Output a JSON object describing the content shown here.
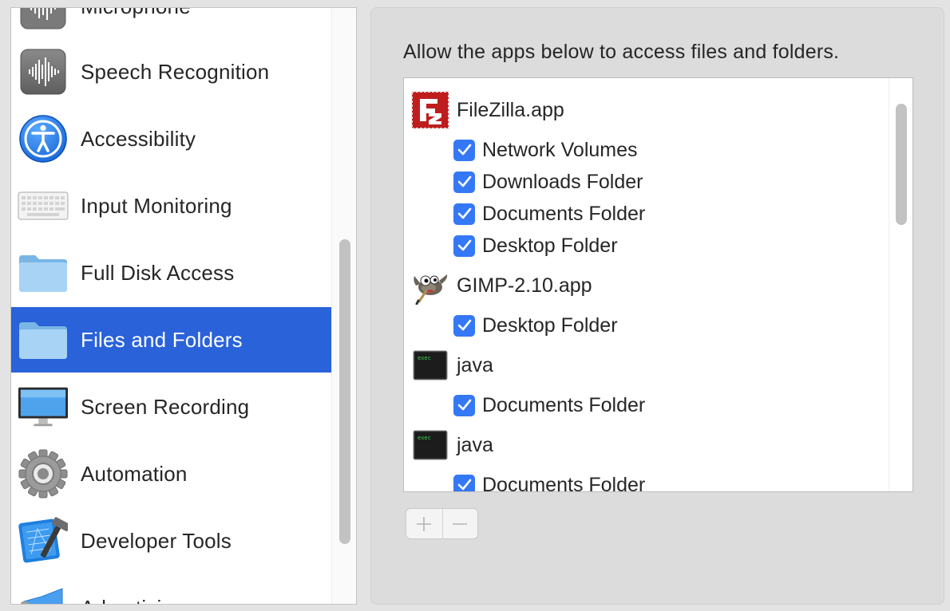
{
  "sidebar": {
    "items": [
      {
        "label": "Microphone",
        "icon": "microphone-icon",
        "selected": false
      },
      {
        "label": "Speech Recognition",
        "icon": "speech-recognition-icon",
        "selected": false
      },
      {
        "label": "Accessibility",
        "icon": "accessibility-icon",
        "selected": false
      },
      {
        "label": "Input Monitoring",
        "icon": "keyboard-icon",
        "selected": false
      },
      {
        "label": "Full Disk Access",
        "icon": "folder-icon",
        "selected": false
      },
      {
        "label": "Files and Folders",
        "icon": "folder-icon",
        "selected": true
      },
      {
        "label": "Screen Recording",
        "icon": "display-icon",
        "selected": false
      },
      {
        "label": "Automation",
        "icon": "gear-icon",
        "selected": false
      },
      {
        "label": "Developer Tools",
        "icon": "xcode-icon",
        "selected": false
      },
      {
        "label": "Advertising",
        "icon": "megaphone-icon",
        "selected": false
      }
    ]
  },
  "panel": {
    "description": "Allow the apps below to access files and folders.",
    "apps": [
      {
        "name": "FileZilla.app",
        "icon": "filezilla-icon",
        "permissions": [
          {
            "label": "Network Volumes",
            "checked": true
          },
          {
            "label": "Downloads Folder",
            "checked": true
          },
          {
            "label": "Documents Folder",
            "checked": true
          },
          {
            "label": "Desktop Folder",
            "checked": true
          }
        ]
      },
      {
        "name": "GIMP-2.10.app",
        "icon": "gimp-icon",
        "permissions": [
          {
            "label": "Desktop Folder",
            "checked": true
          }
        ]
      },
      {
        "name": "java",
        "icon": "terminal-exec-icon",
        "icon_text": "exec",
        "permissions": [
          {
            "label": "Documents Folder",
            "checked": true
          }
        ]
      },
      {
        "name": "java",
        "icon": "terminal-exec-icon",
        "icon_text": "exec",
        "permissions": [
          {
            "label": "Documents Folder",
            "checked": true
          }
        ]
      }
    ],
    "add_symbol": "+",
    "remove_symbol": "−"
  },
  "colors": {
    "selection": "#2962d9",
    "checkbox": "#3478f6",
    "filezilla_red": "#bf1d1d"
  }
}
